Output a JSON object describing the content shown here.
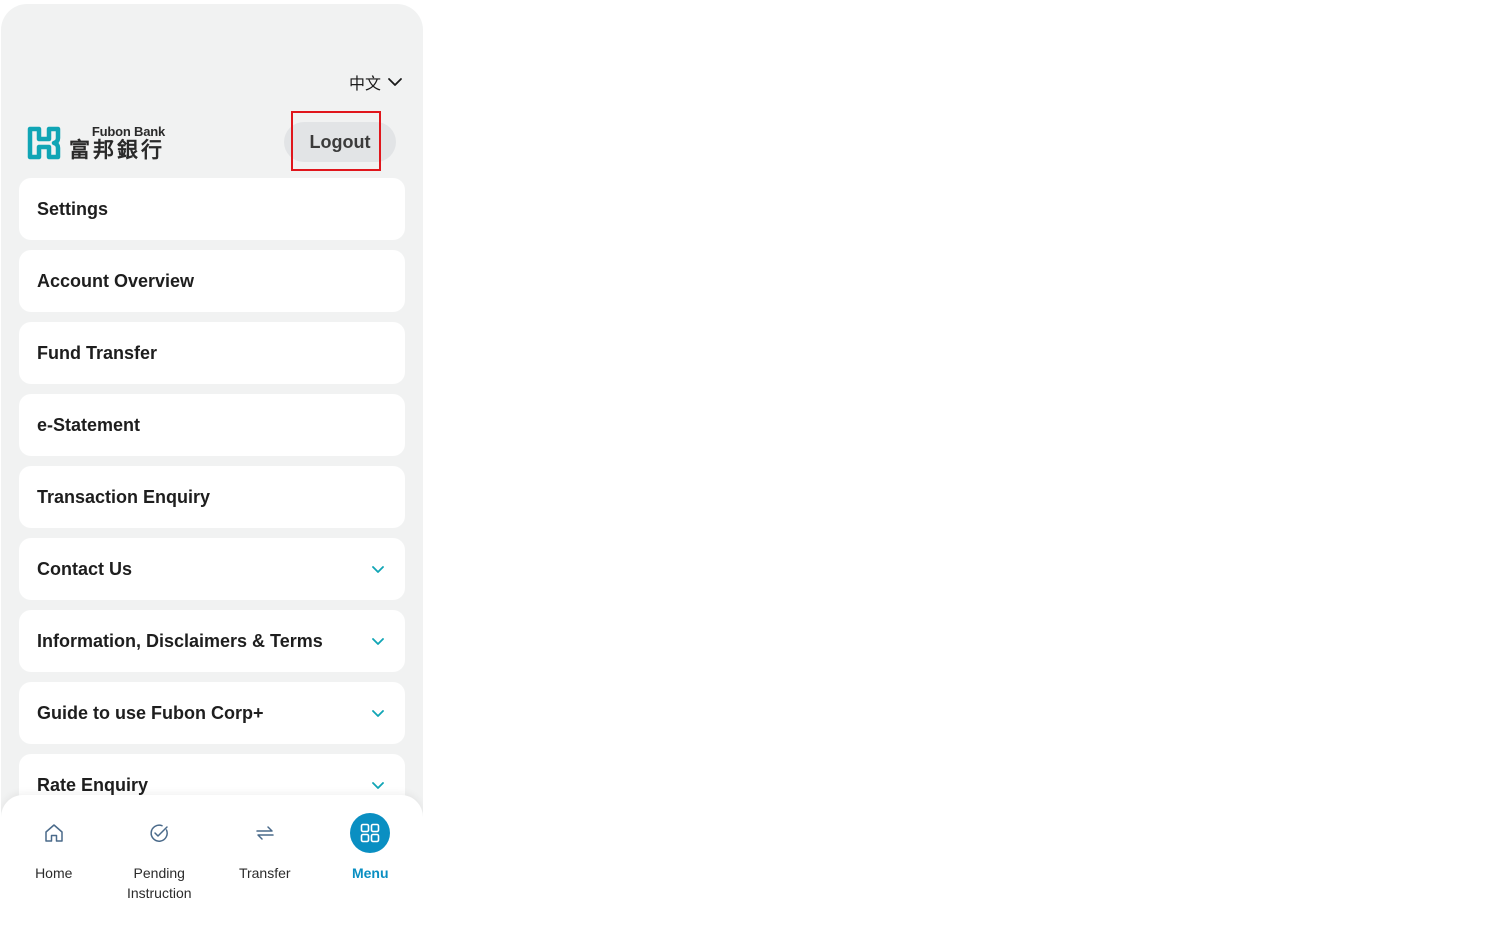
{
  "header": {
    "language_label": "中文",
    "brand_en": "Fubon Bank",
    "brand_zh": "富邦銀行",
    "logout_label": "Logout"
  },
  "menu": {
    "items": [
      {
        "label": "Settings",
        "expandable": false
      },
      {
        "label": "Account Overview",
        "expandable": false
      },
      {
        "label": "Fund Transfer",
        "expandable": false
      },
      {
        "label": "e-Statement",
        "expandable": false
      },
      {
        "label": "Transaction Enquiry",
        "expandable": false
      },
      {
        "label": "Contact Us",
        "expandable": true
      },
      {
        "label": "Information, Disclaimers & Terms",
        "expandable": true
      },
      {
        "label": "Guide to use Fubon Corp+",
        "expandable": true
      },
      {
        "label": "Rate Enquiry",
        "expandable": true
      }
    ]
  },
  "bottom_nav": {
    "items": [
      {
        "label": "Home",
        "icon": "home-icon",
        "active": false
      },
      {
        "label": "Pending\nInstruction",
        "icon": "pending-instruction-icon",
        "active": false
      },
      {
        "label": "Transfer",
        "icon": "transfer-icon",
        "active": false
      },
      {
        "label": "Menu",
        "icon": "menu-grid-icon",
        "active": true
      }
    ]
  },
  "colors": {
    "accent": "#0a8fc2",
    "brand_teal": "#10a5b5",
    "highlight_box": "#e0161c",
    "chevron": "#10a5b5"
  }
}
